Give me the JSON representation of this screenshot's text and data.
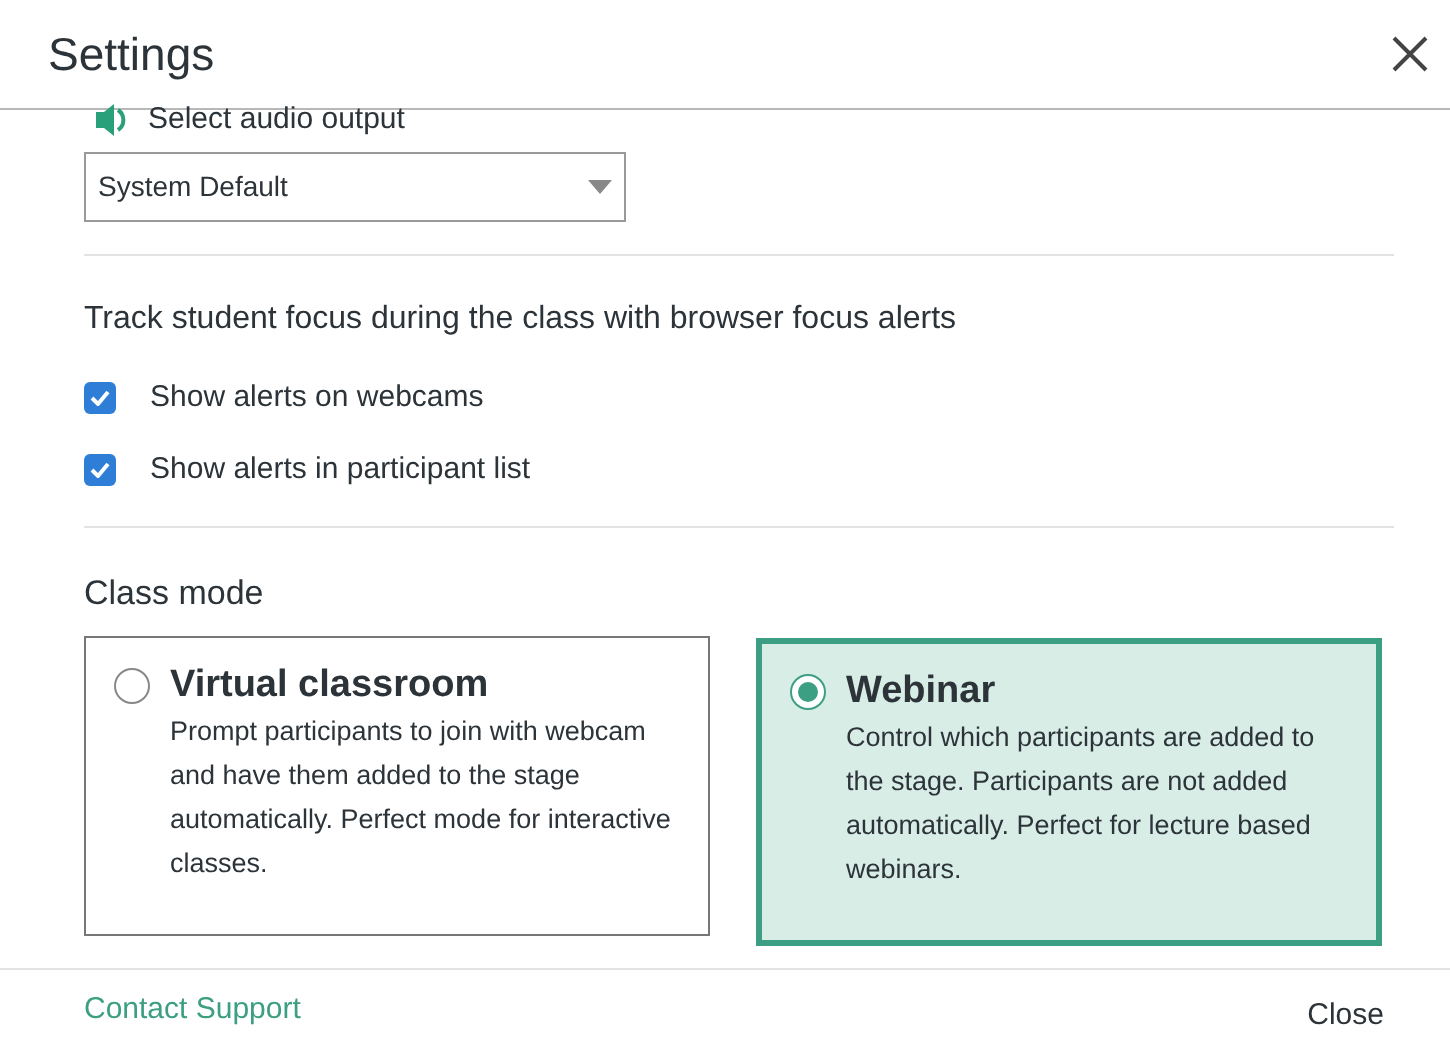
{
  "window": {
    "title": "Settings"
  },
  "audio": {
    "label": "Select audio output",
    "value": "System Default"
  },
  "focus": {
    "title": "Track student focus during the class with browser focus alerts",
    "options": [
      {
        "label": "Show alerts on webcams",
        "checked": true
      },
      {
        "label": "Show alerts in participant list",
        "checked": true
      }
    ]
  },
  "class_mode": {
    "title": "Class mode",
    "options": [
      {
        "title": "Virtual classroom",
        "description": "Prompt participants to join with webcam and have them added to the stage automatically. Perfect mode for interactive classes.",
        "selected": false
      },
      {
        "title": "Webinar",
        "description": "Control which participants are added to the stage. Participants are not added automatically. Perfect for lecture based webinars.",
        "selected": true
      }
    ]
  },
  "footer": {
    "link": "Contact Support",
    "button": "Close"
  }
}
